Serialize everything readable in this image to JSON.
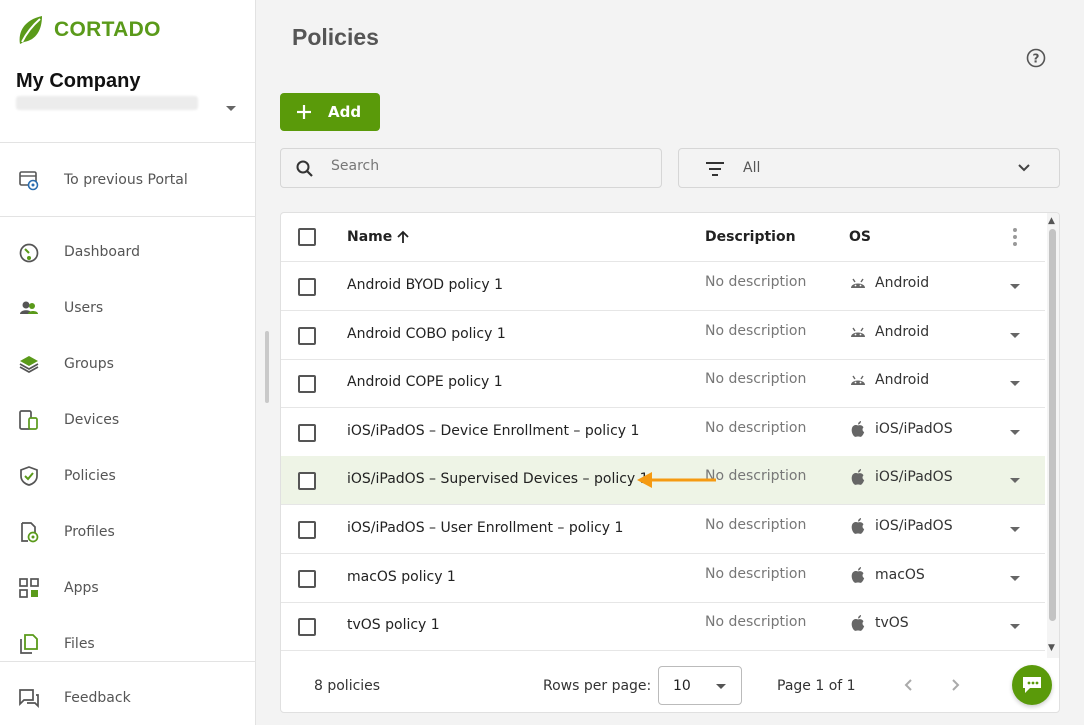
{
  "app": {
    "logo_text": "CORTADO",
    "brand_color": "#5a9a0a"
  },
  "sidebar": {
    "company": "My Company",
    "previous_portal": {
      "label": "To previous Portal",
      "icon": "portal-gear-icon"
    },
    "items": [
      {
        "label": "Dashboard",
        "icon": "dashboard-icon"
      },
      {
        "label": "Users",
        "icon": "users-icon"
      },
      {
        "label": "Groups",
        "icon": "groups-icon"
      },
      {
        "label": "Devices",
        "icon": "devices-icon"
      },
      {
        "label": "Policies",
        "icon": "policies-icon"
      },
      {
        "label": "Profiles",
        "icon": "profiles-icon"
      },
      {
        "label": "Apps",
        "icon": "apps-icon"
      },
      {
        "label": "Files",
        "icon": "files-icon"
      }
    ],
    "feedback": {
      "label": "Feedback",
      "icon": "feedback-icon"
    }
  },
  "main": {
    "title": "Policies",
    "add_label": "Add",
    "search_placeholder": "Search",
    "filter_value": "All"
  },
  "table": {
    "columns": {
      "name": "Name",
      "description": "Description",
      "os": "OS"
    },
    "rows": [
      {
        "name": "Android BYOD policy 1",
        "description": "No description",
        "os": "Android",
        "os_icon": "android-icon"
      },
      {
        "name": "Android COBO policy 1",
        "description": "No description",
        "os": "Android",
        "os_icon": "android-icon"
      },
      {
        "name": "Android COPE policy 1",
        "description": "No description",
        "os": "Android",
        "os_icon": "android-icon"
      },
      {
        "name": "iOS/iPadOS – Device Enrollment – policy 1",
        "description": "No description",
        "os": "iOS/iPadOS",
        "os_icon": "apple-icon"
      },
      {
        "name": "iOS/iPadOS – Supervised Devices – policy 1",
        "description": "No description",
        "os": "iOS/iPadOS",
        "os_icon": "apple-icon",
        "highlighted": true
      },
      {
        "name": "iOS/iPadOS – User Enrollment – policy 1",
        "description": "No description",
        "os": "iOS/iPadOS",
        "os_icon": "apple-icon"
      },
      {
        "name": "macOS policy 1",
        "description": "No description",
        "os": "macOS",
        "os_icon": "apple-icon"
      },
      {
        "name": "tvOS policy 1",
        "description": "No description",
        "os": "tvOS",
        "os_icon": "apple-icon"
      }
    ],
    "footer": {
      "count": "8 policies",
      "rows_per_page_label": "Rows per page:",
      "rows_per_page_value": "10",
      "page_info": "Page 1 of 1"
    }
  },
  "annotation": {
    "arrow_color": "#f59a12"
  }
}
